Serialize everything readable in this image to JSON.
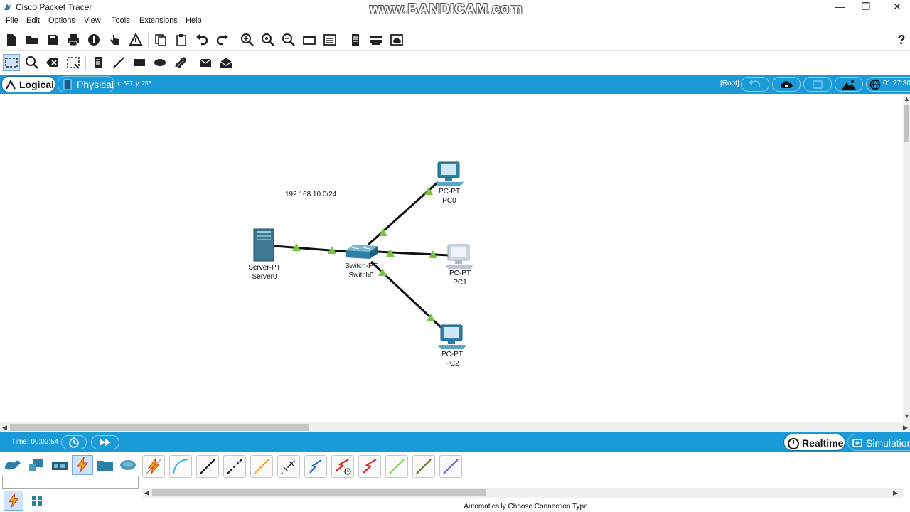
{
  "window": {
    "title": "Cisco Packet Tracer",
    "watermark": "www.BANDICAM.com",
    "minimize": "—",
    "restore": "❐",
    "close": "✕"
  },
  "menu": [
    "File",
    "Edit",
    "Options",
    "View",
    "Tools",
    "Extensions",
    "Help"
  ],
  "toolbar": {
    "help_label": "?"
  },
  "viewbar": {
    "logical_label": "Logical",
    "physical_label": "Physical",
    "coords": "x: 697, y: 256",
    "root_label": "[Root]",
    "clock": "01:27:30"
  },
  "topology": {
    "network_label": "192.168.10.0/24",
    "devices": [
      {
        "type": "Server-PT",
        "name": "Server0"
      },
      {
        "type": "Switch-PT",
        "name": "Switch0"
      },
      {
        "type": "PC-PT",
        "name": "PC0"
      },
      {
        "type": "PC-PT",
        "name": "PC1"
      },
      {
        "type": "PC-PT",
        "name": "PC2"
      }
    ],
    "link_status_color": "#7cc242"
  },
  "bottombar": {
    "time": "Time: 00:02:54",
    "realtime_label": "Realtime",
    "simulation_label": "Simulation"
  },
  "palette": {
    "search_placeholder": "",
    "connection_type": "Automatically Choose Connection Type"
  },
  "colors": {
    "accent_blue": "#1a9ad6"
  }
}
